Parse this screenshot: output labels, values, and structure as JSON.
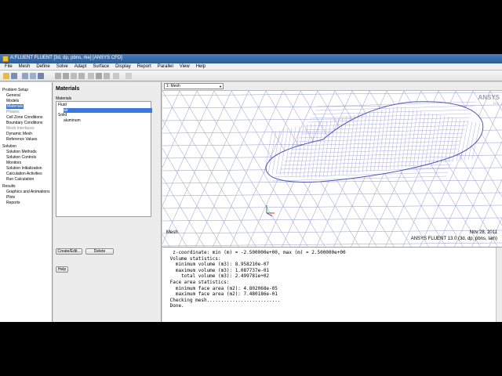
{
  "window": {
    "title": "A:FLUENT FLUENT [3d, dp, pbns, rke] [ANSYS CFD]"
  },
  "menus": [
    "File",
    "Mesh",
    "Define",
    "Solve",
    "Adapt",
    "Surface",
    "Display",
    "Report",
    "Parallel",
    "View",
    "Help"
  ],
  "tree": {
    "items": [
      {
        "label": "Problem Setup",
        "level": 0
      },
      {
        "label": "General",
        "level": 1
      },
      {
        "label": "Models",
        "level": 1
      },
      {
        "label": "Materials",
        "level": 1,
        "selected": true
      },
      {
        "label": "Phases",
        "level": 1,
        "dim": true
      },
      {
        "label": "Cell Zone Conditions",
        "level": 1
      },
      {
        "label": "Boundary Conditions",
        "level": 1
      },
      {
        "label": "Mesh Interfaces",
        "level": 1,
        "dim": true
      },
      {
        "label": "Dynamic Mesh",
        "level": 1
      },
      {
        "label": "Reference Values",
        "level": 1
      },
      {
        "label": "Solution",
        "level": 0
      },
      {
        "label": "Solution Methods",
        "level": 1
      },
      {
        "label": "Solution Controls",
        "level": 1
      },
      {
        "label": "Monitors",
        "level": 1
      },
      {
        "label": "Solution Initialization",
        "level": 1
      },
      {
        "label": "Calculation Activities",
        "level": 1
      },
      {
        "label": "Run Calculation",
        "level": 1
      },
      {
        "label": "Results",
        "level": 0
      },
      {
        "label": "Graphics and Animations",
        "level": 1
      },
      {
        "label": "Plots",
        "level": 1
      },
      {
        "label": "Reports",
        "level": 1
      }
    ]
  },
  "task": {
    "heading": "Materials",
    "list_label": "Materials",
    "materials": [
      {
        "label": "Fluid",
        "level": 0
      },
      {
        "label": "air",
        "level": 1,
        "selected": true
      },
      {
        "label": "Solid",
        "level": 0
      },
      {
        "label": "aluminum",
        "level": 1
      }
    ],
    "create_edit_label": "Create/Edit...",
    "delete_label": "Delete",
    "help_label": "Help"
  },
  "graphics": {
    "window_select": "1: Mesh",
    "label": "Mesh",
    "date": "Nov 28, 2011",
    "version": "ANSYS FLUENT 13.0 (3d, dp, pbns, lam)",
    "logo": "ANSYS",
    "logo_sub": "13.0"
  },
  "console": {
    "lines": [
      "  z-coordinate: min (m) = -2.500000e+00, max (m) = 2.500000e+00",
      " Volume statistics:",
      "   minimum volume (m3): 8.958210e-07",
      "   maximum volume (m3): 1.087737e-01",
      "     total volume (m3): 2.499781e+02",
      " Face area statistics:",
      "   minimum face area (m2): 4.802068e-05",
      "   maximum face area (m2): 7.480186e-01",
      " Checking mesh..........................",
      " Done."
    ]
  }
}
